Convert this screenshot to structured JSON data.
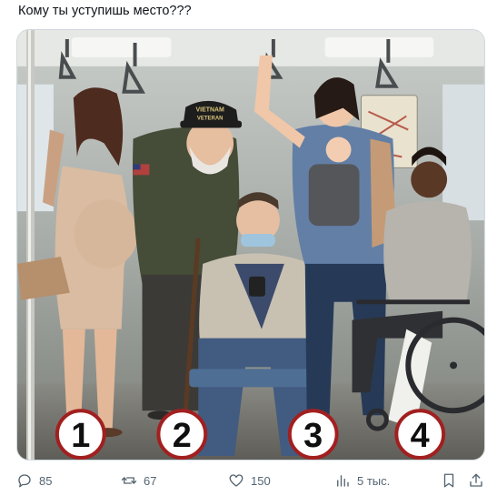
{
  "post": {
    "text": "Кому ты уступишь место???"
  },
  "image": {
    "badges": [
      "1",
      "2",
      "3",
      "4"
    ],
    "cap_text_line1": "VIETNAM",
    "cap_text_line2": "VETERAN"
  },
  "actions": {
    "reply_count": "85",
    "retweet_count": "67",
    "like_count": "150",
    "views_count": "5 тыс."
  },
  "icons": {
    "reply": "reply-icon",
    "retweet": "retweet-icon",
    "like": "heart-icon",
    "views": "views-icon",
    "bookmark": "bookmark-icon",
    "share": "share-icon"
  }
}
